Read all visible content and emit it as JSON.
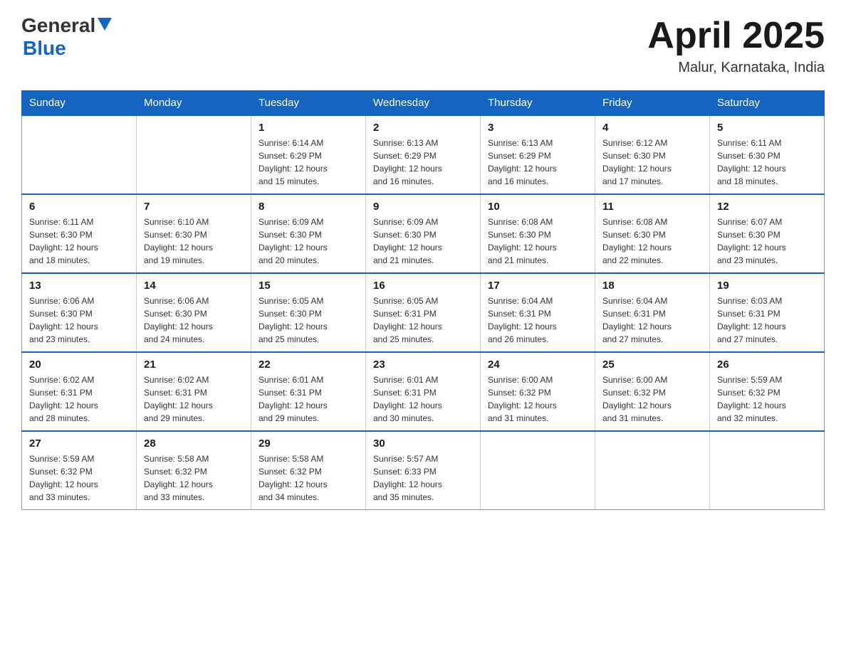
{
  "logo": {
    "general": "General",
    "blue": "Blue"
  },
  "header": {
    "title": "April 2025",
    "location": "Malur, Karnataka, India"
  },
  "days": {
    "headers": [
      "Sunday",
      "Monday",
      "Tuesday",
      "Wednesday",
      "Thursday",
      "Friday",
      "Saturday"
    ]
  },
  "weeks": [
    {
      "cells": [
        {
          "day": "",
          "info": ""
        },
        {
          "day": "",
          "info": ""
        },
        {
          "day": "1",
          "info": "Sunrise: 6:14 AM\nSunset: 6:29 PM\nDaylight: 12 hours\nand 15 minutes."
        },
        {
          "day": "2",
          "info": "Sunrise: 6:13 AM\nSunset: 6:29 PM\nDaylight: 12 hours\nand 16 minutes."
        },
        {
          "day": "3",
          "info": "Sunrise: 6:13 AM\nSunset: 6:29 PM\nDaylight: 12 hours\nand 16 minutes."
        },
        {
          "day": "4",
          "info": "Sunrise: 6:12 AM\nSunset: 6:30 PM\nDaylight: 12 hours\nand 17 minutes."
        },
        {
          "day": "5",
          "info": "Sunrise: 6:11 AM\nSunset: 6:30 PM\nDaylight: 12 hours\nand 18 minutes."
        }
      ]
    },
    {
      "cells": [
        {
          "day": "6",
          "info": "Sunrise: 6:11 AM\nSunset: 6:30 PM\nDaylight: 12 hours\nand 18 minutes."
        },
        {
          "day": "7",
          "info": "Sunrise: 6:10 AM\nSunset: 6:30 PM\nDaylight: 12 hours\nand 19 minutes."
        },
        {
          "day": "8",
          "info": "Sunrise: 6:09 AM\nSunset: 6:30 PM\nDaylight: 12 hours\nand 20 minutes."
        },
        {
          "day": "9",
          "info": "Sunrise: 6:09 AM\nSunset: 6:30 PM\nDaylight: 12 hours\nand 21 minutes."
        },
        {
          "day": "10",
          "info": "Sunrise: 6:08 AM\nSunset: 6:30 PM\nDaylight: 12 hours\nand 21 minutes."
        },
        {
          "day": "11",
          "info": "Sunrise: 6:08 AM\nSunset: 6:30 PM\nDaylight: 12 hours\nand 22 minutes."
        },
        {
          "day": "12",
          "info": "Sunrise: 6:07 AM\nSunset: 6:30 PM\nDaylight: 12 hours\nand 23 minutes."
        }
      ]
    },
    {
      "cells": [
        {
          "day": "13",
          "info": "Sunrise: 6:06 AM\nSunset: 6:30 PM\nDaylight: 12 hours\nand 23 minutes."
        },
        {
          "day": "14",
          "info": "Sunrise: 6:06 AM\nSunset: 6:30 PM\nDaylight: 12 hours\nand 24 minutes."
        },
        {
          "day": "15",
          "info": "Sunrise: 6:05 AM\nSunset: 6:30 PM\nDaylight: 12 hours\nand 25 minutes."
        },
        {
          "day": "16",
          "info": "Sunrise: 6:05 AM\nSunset: 6:31 PM\nDaylight: 12 hours\nand 25 minutes."
        },
        {
          "day": "17",
          "info": "Sunrise: 6:04 AM\nSunset: 6:31 PM\nDaylight: 12 hours\nand 26 minutes."
        },
        {
          "day": "18",
          "info": "Sunrise: 6:04 AM\nSunset: 6:31 PM\nDaylight: 12 hours\nand 27 minutes."
        },
        {
          "day": "19",
          "info": "Sunrise: 6:03 AM\nSunset: 6:31 PM\nDaylight: 12 hours\nand 27 minutes."
        }
      ]
    },
    {
      "cells": [
        {
          "day": "20",
          "info": "Sunrise: 6:02 AM\nSunset: 6:31 PM\nDaylight: 12 hours\nand 28 minutes."
        },
        {
          "day": "21",
          "info": "Sunrise: 6:02 AM\nSunset: 6:31 PM\nDaylight: 12 hours\nand 29 minutes."
        },
        {
          "day": "22",
          "info": "Sunrise: 6:01 AM\nSunset: 6:31 PM\nDaylight: 12 hours\nand 29 minutes."
        },
        {
          "day": "23",
          "info": "Sunrise: 6:01 AM\nSunset: 6:31 PM\nDaylight: 12 hours\nand 30 minutes."
        },
        {
          "day": "24",
          "info": "Sunrise: 6:00 AM\nSunset: 6:32 PM\nDaylight: 12 hours\nand 31 minutes."
        },
        {
          "day": "25",
          "info": "Sunrise: 6:00 AM\nSunset: 6:32 PM\nDaylight: 12 hours\nand 31 minutes."
        },
        {
          "day": "26",
          "info": "Sunrise: 5:59 AM\nSunset: 6:32 PM\nDaylight: 12 hours\nand 32 minutes."
        }
      ]
    },
    {
      "cells": [
        {
          "day": "27",
          "info": "Sunrise: 5:59 AM\nSunset: 6:32 PM\nDaylight: 12 hours\nand 33 minutes."
        },
        {
          "day": "28",
          "info": "Sunrise: 5:58 AM\nSunset: 6:32 PM\nDaylight: 12 hours\nand 33 minutes."
        },
        {
          "day": "29",
          "info": "Sunrise: 5:58 AM\nSunset: 6:32 PM\nDaylight: 12 hours\nand 34 minutes."
        },
        {
          "day": "30",
          "info": "Sunrise: 5:57 AM\nSunset: 6:33 PM\nDaylight: 12 hours\nand 35 minutes."
        },
        {
          "day": "",
          "info": ""
        },
        {
          "day": "",
          "info": ""
        },
        {
          "day": "",
          "info": ""
        }
      ]
    }
  ]
}
